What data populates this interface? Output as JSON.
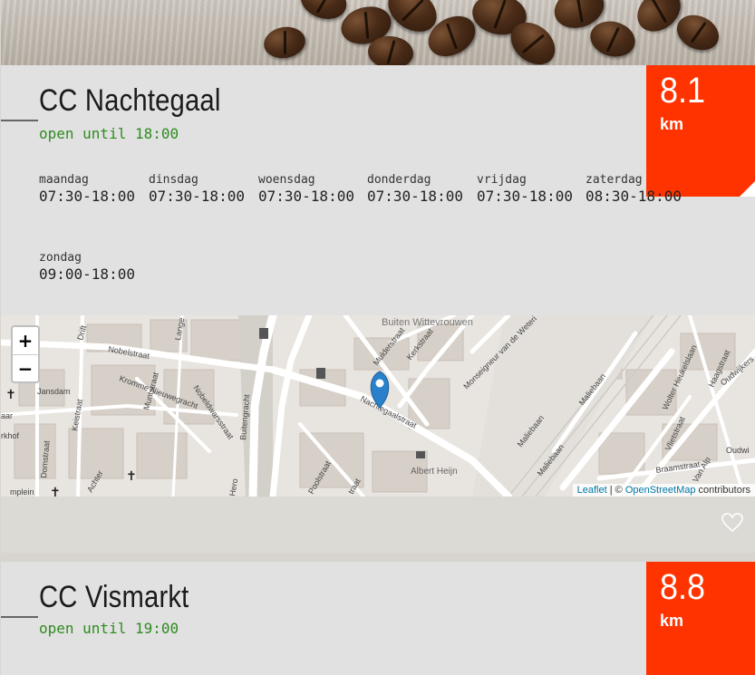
{
  "locations": [
    {
      "name": "CC Nachtegaal",
      "status": "open until 18:00",
      "distance": "8.1",
      "distance_unit": "km",
      "hours": [
        {
          "day": "maandag",
          "time": "07:30-18:00"
        },
        {
          "day": "dinsdag",
          "time": "07:30-18:00"
        },
        {
          "day": "woensdag",
          "time": "07:30-18:00"
        },
        {
          "day": "donderdag",
          "time": "07:30-18:00"
        },
        {
          "day": "vrijdag",
          "time": "07:30-18:00"
        },
        {
          "day": "zaterdag",
          "time": "08:30-18:00"
        },
        {
          "day": "zondag",
          "time": "09:00-18:00"
        }
      ],
      "map": {
        "zoom_in": "+",
        "zoom_out": "−",
        "attribution": {
          "leaflet": "Leaflet",
          "separator": " | © ",
          "osm": "OpenStreetMap",
          "suffix": " contributors"
        },
        "labels": {
          "buiten_wittevrouwen": "Buiten Wittevrouwen",
          "nobelstraat": "Nobelstraat",
          "nachtegaalstraat": "Nachtegaalstraat",
          "mulderstraat": "Mulderstraat",
          "kerkstraat": "Kerkstraat",
          "monseigneur": "Monseigneur van de Weteri",
          "malebaan": "Maliebaan",
          "albert_heijn": "Albert Heijn",
          "jansdam": "Jansdam",
          "kromme_nieuwegracht": "Kromme Nieuwegracht",
          "nobeldwarsstraat": "Nobeldwarsstraat",
          "muntstraat": "Muntstraat",
          "keistraat": "Keistraat",
          "domstraat": "Domstraat",
          "achter": "Achter",
          "wolter_heukelslaan": "Wolter Heukelslaan",
          "haagstraat": "Haagstraat",
          "vlietstraat": "Vlietstraat",
          "braamstraat": "Braamstraat",
          "poolstraat": "Poolstraat",
          "drift": "Drift",
          "lange": "Lange",
          "oudwijkers": "Oudwijkers",
          "oudwi": "Oudwi",
          "van_alp": "Van Alp",
          "herd": "Hero",
          "buitengracht": "Buitengracht",
          "rkhof": "rkhof",
          "traat": "traat",
          "mplein": "mplein",
          "aar": "aar"
        }
      }
    },
    {
      "name": "CC Vismarkt",
      "status": "open until 19:00",
      "distance": "8.8",
      "distance_unit": "km"
    }
  ],
  "colors": {
    "accent": "#ff3300",
    "status_open": "#2e8b1e",
    "map_pin": "#2a81cb"
  },
  "icons": {
    "favorite": "heart-outline-icon",
    "pin": "map-pin-icon"
  }
}
